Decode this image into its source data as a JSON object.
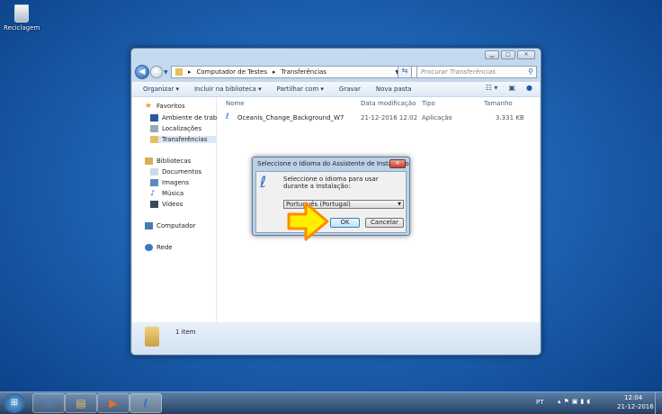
{
  "desktop": {
    "recycle_bin": "Reciclagem"
  },
  "explorer": {
    "breadcrumb": [
      "Computador de Testes",
      "Transferências"
    ],
    "search_placeholder": "Procurar Transferências",
    "toolbar": {
      "organize": "Organizar",
      "include": "Incluir na biblioteca",
      "share": "Partilhar com",
      "burn": "Gravar",
      "new_folder": "Nova pasta"
    },
    "nav": {
      "favorites": "Favoritos",
      "desktop": "Ambiente de trabalho",
      "places": "Localizações",
      "downloads": "Transferências",
      "libraries": "Bibliotecas",
      "documents": "Documentos",
      "images": "Imagens",
      "music": "Música",
      "videos": "Vídeos",
      "computer": "Computador",
      "network": "Rede"
    },
    "columns": [
      "Nome",
      "Data modificação",
      "Tipo",
      "Tamanho"
    ],
    "files": [
      {
        "name": "Oceanis_Change_Background_W7",
        "date": "21-12-2016 12:02",
        "type": "Aplicação",
        "size": "3.331 KB"
      }
    ],
    "status": "1 item"
  },
  "dialog": {
    "title": "Seleccione o Idioma do Assistente de Instalação",
    "message": "Seleccione o idioma para usar durante a Instalação:",
    "language": "Português (Portugal)",
    "ok": "OK",
    "cancel": "Cancelar"
  },
  "taskbar": {
    "lang": "PT",
    "time": "12:04",
    "date": "21-12-2016"
  },
  "colors": {
    "arrow": "#ffee00",
    "arrow_border": "#ff8c00"
  }
}
